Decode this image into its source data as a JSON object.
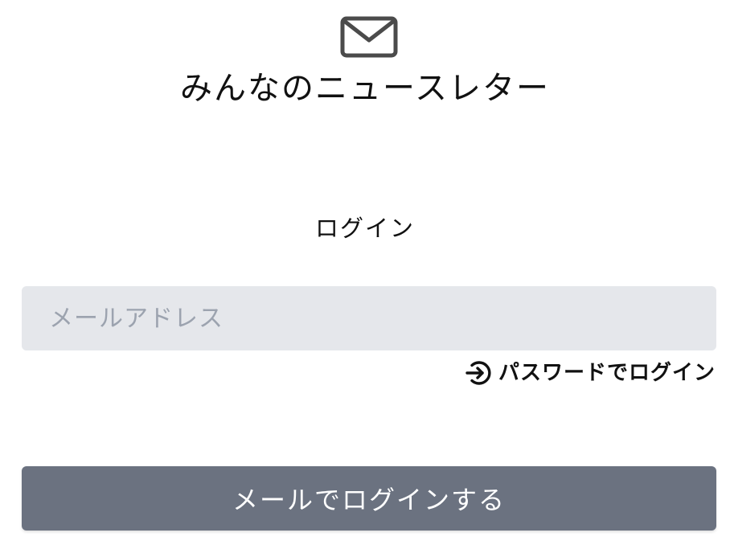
{
  "app": {
    "title": "みんなのニュースレター",
    "logo_icon": "envelope-icon"
  },
  "login": {
    "heading": "ログイン",
    "email": {
      "placeholder": "メールアドレス",
      "value": ""
    },
    "password_link": {
      "icon": "login-arrow-icon",
      "label": "パスワードでログイン"
    },
    "submit_label": "メールでログインする"
  },
  "colors": {
    "input_background": "#e5e7eb",
    "placeholder": "#9ca3af",
    "button_background": "#6b7280",
    "button_text": "#ffffff",
    "text": "#111111"
  }
}
